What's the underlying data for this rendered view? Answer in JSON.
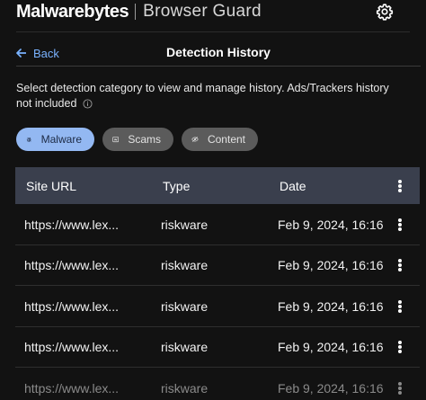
{
  "header": {
    "logo_text": "Malwarebytes",
    "product_name": "Browser Guard"
  },
  "nav": {
    "back_label": "Back",
    "page_title": "Detection History"
  },
  "description": "Select detection category to view and manage history. Ads/Trackers history not included",
  "filters": [
    {
      "label": "Malware",
      "icon": "bug-icon",
      "selected": true
    },
    {
      "label": "Scams",
      "icon": "scam-icon",
      "selected": false
    },
    {
      "label": "Content",
      "icon": "content-blocked-icon",
      "selected": false
    }
  ],
  "table": {
    "columns": [
      "Site URL",
      "Type",
      "Date"
    ],
    "rows": [
      {
        "url": "https://www.lex...",
        "type": "riskware",
        "date": "Feb 9, 2024, 16:16"
      },
      {
        "url": "https://www.lex...",
        "type": "riskware",
        "date": "Feb 9, 2024, 16:16"
      },
      {
        "url": "https://www.lex...",
        "type": "riskware",
        "date": "Feb 9, 2024, 16:16"
      },
      {
        "url": "https://www.lex...",
        "type": "riskware",
        "date": "Feb 9, 2024, 16:16"
      },
      {
        "url": "https://www.lex...",
        "type": "riskware",
        "date": "Feb 9, 2024, 16:16"
      }
    ]
  },
  "colors": {
    "background": "#121212",
    "accent_link": "#7ab3ff",
    "chip_selected": "#93b8f2",
    "chip_unselected": "#5b5b5b",
    "table_header": "#3a3f4d"
  }
}
